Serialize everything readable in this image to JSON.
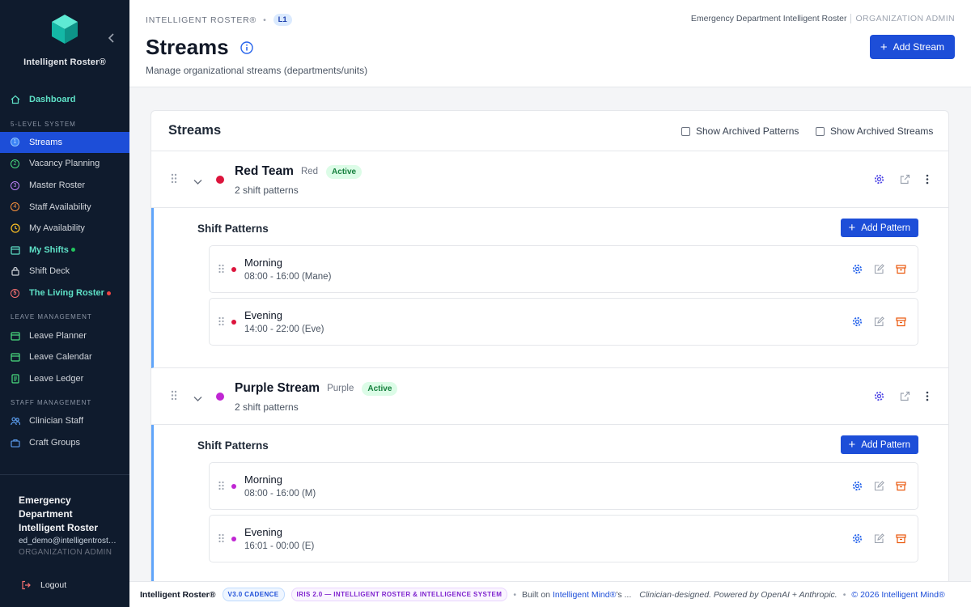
{
  "sidebar": {
    "brand": "Intelligent Roster®",
    "nav_top": [
      {
        "label": "Dashboard"
      }
    ],
    "section_5level": "5-LEVEL SYSTEM",
    "nav_5level": [
      {
        "label": "Streams",
        "num": "1"
      },
      {
        "label": "Vacancy Planning",
        "num": "2"
      },
      {
        "label": "Master Roster",
        "num": "3"
      },
      {
        "label": "Staff Availability",
        "num": "4"
      },
      {
        "label": "My Availability"
      },
      {
        "label": "My Shifts"
      },
      {
        "label": "Shift Deck"
      },
      {
        "label": "The Living Roster",
        "num": "5"
      }
    ],
    "section_leave": "LEAVE MANAGEMENT",
    "nav_leave": [
      {
        "label": "Leave Planner"
      },
      {
        "label": "Leave Calendar"
      },
      {
        "label": "Leave Ledger"
      }
    ],
    "section_staff": "STAFF MANAGEMENT",
    "nav_staff": [
      {
        "label": "Clinician Staff"
      },
      {
        "label": "Craft Groups"
      }
    ],
    "user": {
      "org": "Emergency Department Intelligent Roster",
      "email": "ed_demo@intelligentroster.com",
      "role": "ORGANIZATION ADMIN"
    },
    "logout": "Logout"
  },
  "header": {
    "breadcrumb": "INTELLIGENT ROSTER®",
    "level_badge": "L1",
    "title": "Streams",
    "subtitle": "Manage organizational streams (departments/units)",
    "org_name": "Emergency Department Intelligent Roster",
    "org_role": "ORGANIZATION ADMIN",
    "add_stream": "Add Stream"
  },
  "card": {
    "title": "Streams",
    "show_archived_patterns": "Show Archived Patterns",
    "show_archived_streams": "Show Archived Streams",
    "patterns_title": "Shift Patterns",
    "add_pattern": "Add Pattern"
  },
  "streams": [
    {
      "name": "Red Team",
      "color_name": "Red",
      "color": "#dc143c",
      "status": "Active",
      "count": "2 shift patterns",
      "patterns": [
        {
          "name": "Morning",
          "time": "08:00 - 16:00 (Mane)"
        },
        {
          "name": "Evening",
          "time": "14:00 - 22:00 (Eve)"
        }
      ]
    },
    {
      "name": "Purple Stream",
      "color_name": "Purple",
      "color": "#c026d3",
      "status": "Active",
      "count": "2 shift patterns",
      "patterns": [
        {
          "name": "Morning",
          "time": "08:00 - 16:00 (M)"
        },
        {
          "name": "Evening",
          "time": "16:01 - 00:00 (E)"
        }
      ]
    }
  ],
  "footer": {
    "brand": "Intelligent Roster®",
    "version": "V3.0 CADENCE",
    "system": "IRIS 2.0 — INTELLIGENT ROSTER & INTELLIGENCE SYSTEM",
    "built_prefix": "Built on",
    "built_link": "Intelligent Mind®",
    "built_suffix": "'s ...",
    "tagline": "Clinician-designed. Powered by OpenAI + Anthropic.",
    "copyright": "© 2026 Intelligent Mind®"
  },
  "colors": {
    "sidebar_bg": "#0f1b2d",
    "primary": "#1d4ed8",
    "highlight": "#5ee0c6",
    "active_badge": "#15803d",
    "archive": "#ea580c"
  }
}
